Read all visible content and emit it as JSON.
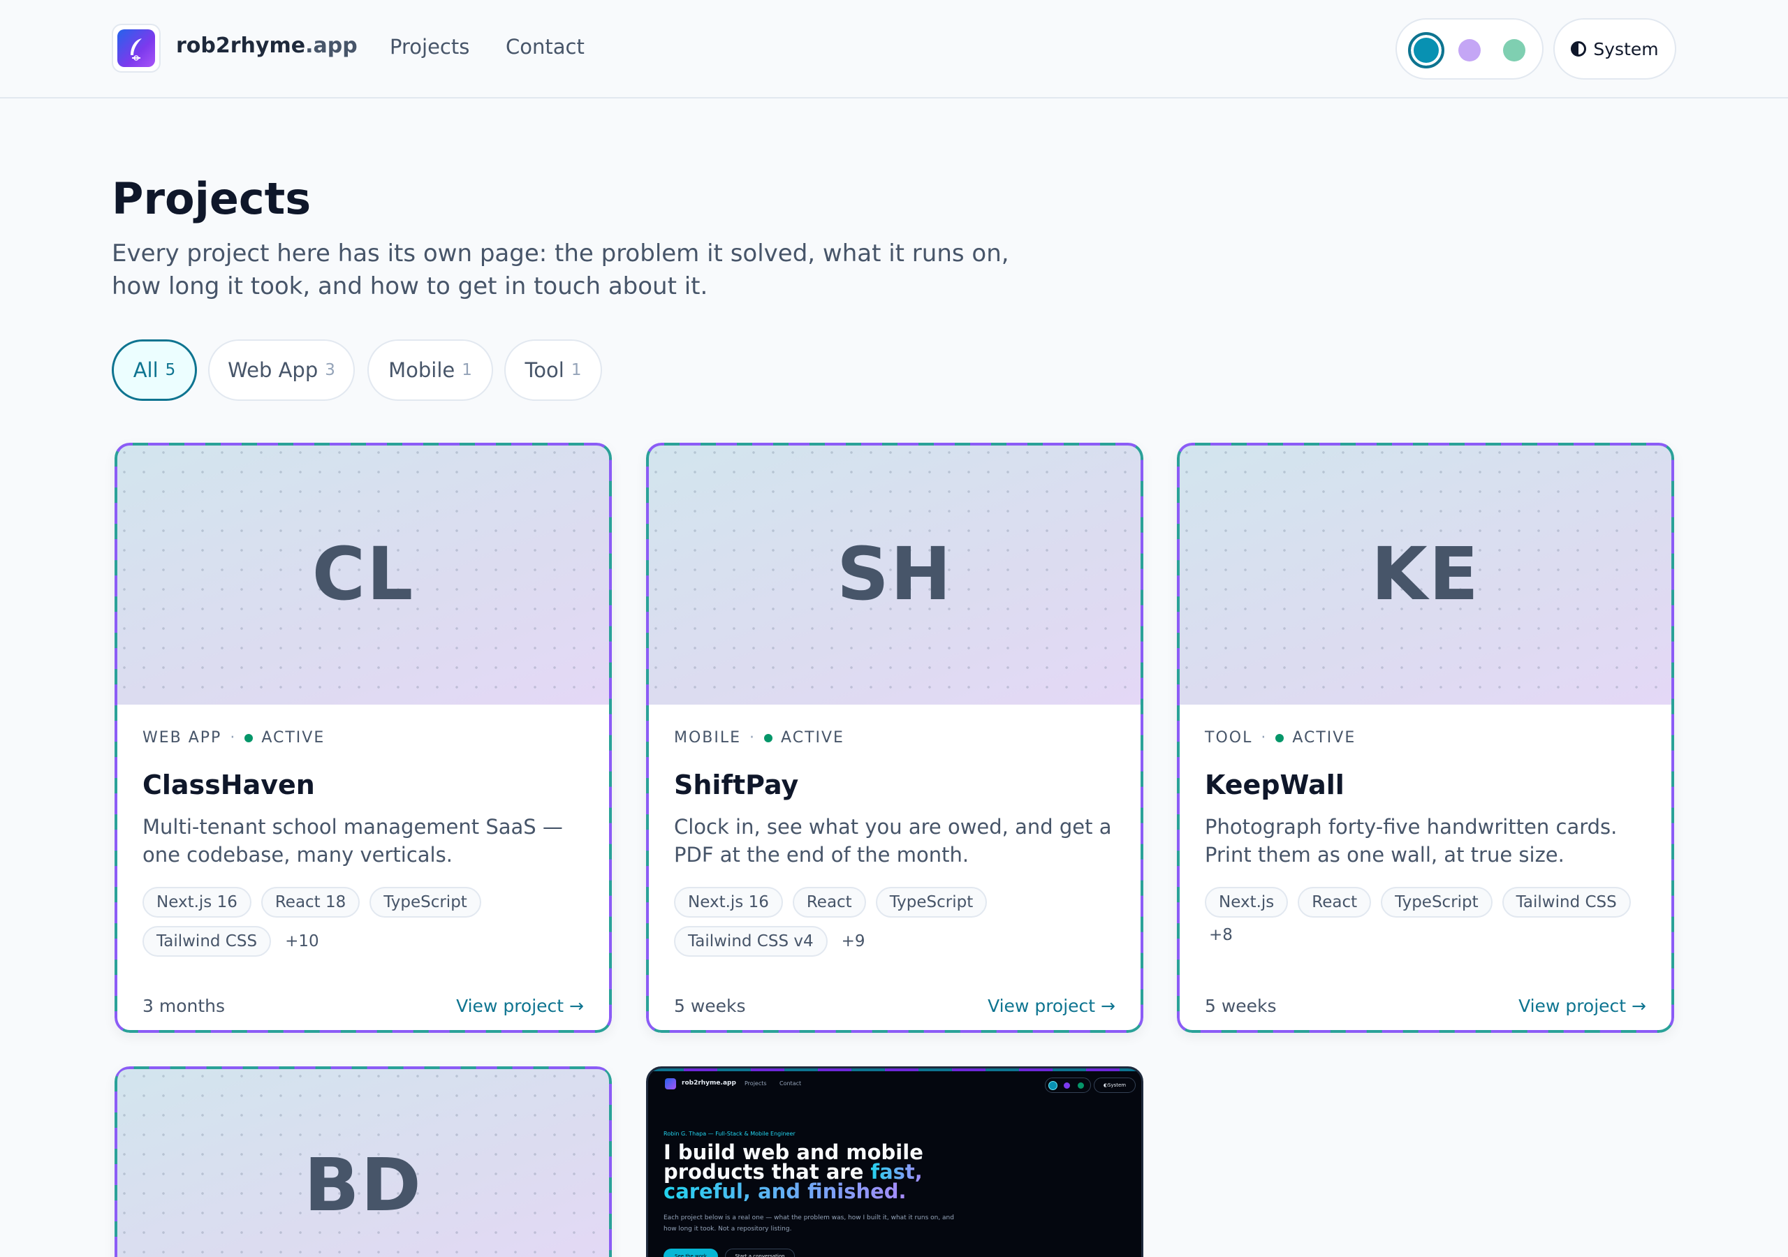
{
  "header": {
    "brand_name": "rob2rhyme",
    "brand_tld": ".app",
    "nav": [
      "Projects",
      "Contact"
    ],
    "theme_label": "System",
    "accent_swatches": [
      "#0891b2",
      "#c4a6f5",
      "#7fcfb1"
    ]
  },
  "intro": {
    "title": "Projects",
    "subtitle": "Every project here has its own page: the problem it solved, what it runs on, how long it took, and how to get in touch about it."
  },
  "filters": [
    {
      "label": "All",
      "count": "5",
      "active": true
    },
    {
      "label": "Web App",
      "count": "3",
      "active": false
    },
    {
      "label": "Mobile",
      "count": "1",
      "active": false
    },
    {
      "label": "Tool",
      "count": "1",
      "active": false
    }
  ],
  "cards": [
    {
      "initials": "CL",
      "category": "WEB APP",
      "status": "ACTIVE",
      "title": "ClassHaven",
      "description": "Multi-tenant school management SaaS — one codebase, many verticals.",
      "tags": [
        "Next.js 16",
        "React 18",
        "TypeScript",
        "Tailwind CSS"
      ],
      "more": "+10",
      "duration": "3 months",
      "link": "View project →"
    },
    {
      "initials": "SH",
      "category": "MOBILE",
      "status": "ACTIVE",
      "title": "ShiftPay",
      "description": "Clock in, see what you are owed, and get a PDF at the end of the month.",
      "tags": [
        "Next.js 16",
        "React",
        "TypeScript",
        "Tailwind CSS v4"
      ],
      "more": "+9",
      "duration": "5 weeks",
      "link": "View project →"
    },
    {
      "initials": "KE",
      "category": "TOOL",
      "status": "ACTIVE",
      "title": "KeepWall",
      "description": "Photograph forty-five handwritten cards. Print them as one wall, at true size.",
      "tags": [
        "Next.js",
        "React",
        "TypeScript",
        "Tailwind CSS"
      ],
      "more": "+8",
      "duration": "5 weeks",
      "link": "View project →"
    },
    {
      "initials": "BD"
    }
  ],
  "screenshot_card": {
    "brand": "rob2rhyme.app",
    "nav": [
      "Projects",
      "Contact"
    ],
    "theme_label": "System",
    "eyebrow": "Robin G. Thapa — Full-Stack & Mobile Engineer",
    "headline_line1": "I build web and mobile",
    "headline_line2_pre": "products that are ",
    "headline_accent1": "fast,",
    "headline_accent2": "careful, and finished.",
    "paragraph": "Each project below is a real one — what the problem was, how I built it, what it runs on, and how long it took. Not a repository listing.",
    "primary_button": "See the work",
    "secondary_button": "Start a conversation"
  }
}
